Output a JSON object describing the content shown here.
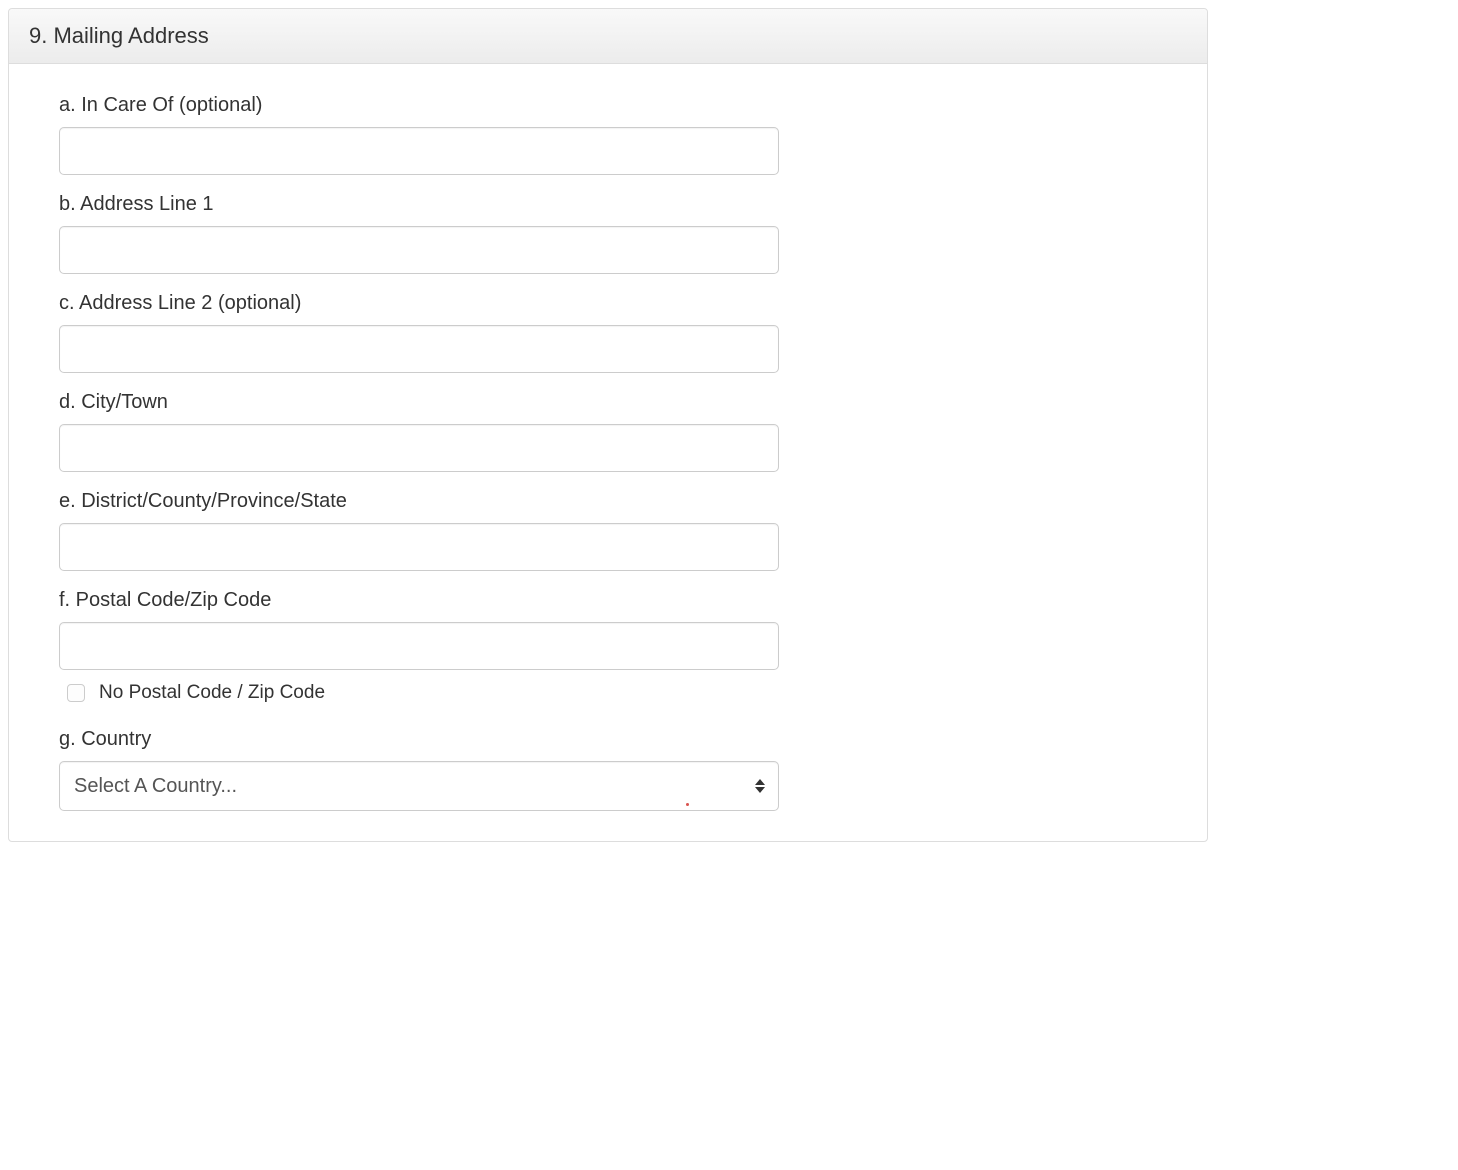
{
  "panel": {
    "title": "9. Mailing Address"
  },
  "fields": {
    "inCareOf": {
      "label": "a. In Care Of (optional)",
      "value": ""
    },
    "addressLine1": {
      "label": "b. Address Line 1",
      "value": ""
    },
    "addressLine2": {
      "label": "c. Address Line 2 (optional)",
      "value": ""
    },
    "cityTown": {
      "label": "d. City/Town",
      "value": ""
    },
    "district": {
      "label": "e. District/County/Province/State",
      "value": ""
    },
    "postalCode": {
      "label": "f. Postal Code/Zip Code",
      "value": ""
    },
    "noPostalCode": {
      "label": "No Postal Code / Zip Code"
    },
    "country": {
      "label": "g. Country",
      "selected": "Select A Country..."
    }
  }
}
